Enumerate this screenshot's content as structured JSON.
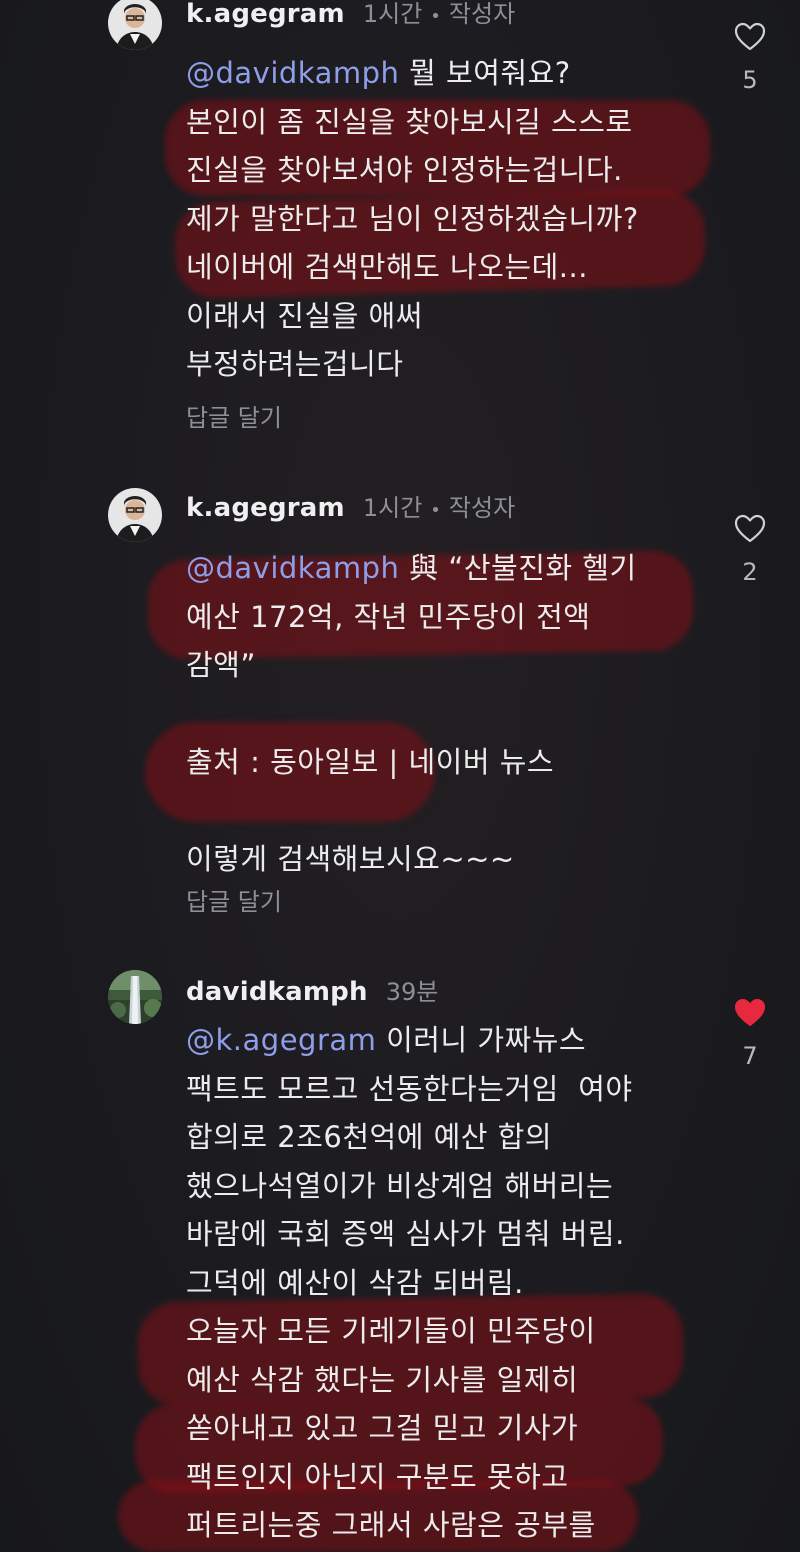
{
  "comments": [
    {
      "username": "k.agegram",
      "time": "1시간",
      "author_tag": "작성자",
      "mention": "@davidkamph",
      "first_line_rest": " 뭘 보여줘요?",
      "lines": [
        "본인이 좀 진실을 찾아보시길 스스로",
        "진실을 찾아보셔야 인정하는겁니다.",
        "제가 말한다고 님이 인정하겠습니까?",
        "네이버에 검색만해도 나오는데...",
        "이래서 진실을 애써",
        "부정하려는겁니다"
      ],
      "reply": "답글 달기",
      "likes": "5",
      "liked": false
    },
    {
      "username": "k.agegram",
      "time": "1시간",
      "author_tag": "작성자",
      "mention": "@davidkamph",
      "first_line_rest": " 與 “산불진화 헬기",
      "lines": [
        "예산 172억, 작년 민주당이 전액",
        "감액”",
        "",
        "출처 : 동아일보 | 네이버 뉴스",
        "",
        "이렇게 검색해보시요~~~"
      ],
      "reply": "답글 달기",
      "likes": "2",
      "liked": false
    },
    {
      "username": "davidkamph",
      "time": "39분",
      "mention": "@k.agegram",
      "first_line_rest": " 이러니 가짜뉴스",
      "lines": [
        "팩트도 모르고 선동한다는거임  여야",
        "합의로 2조6천억에 예산 합의",
        "했으나석열이가 비상계엄 해버리는",
        "바람에 국회 증액 심사가 멈춰 버림.",
        "그덕에 예산이 삭감 되버림.",
        "오늘자 모든 기레기들이 민주당이",
        "예산 삭감 했다는 기사를 일제히",
        "쏟아내고 있고 그걸 믿고 기사가",
        "팩트인지 아닌지 구분도 못하고",
        "퍼트리는중 그래서 사람은 공부를"
      ],
      "likes": "7",
      "liked": true
    }
  ],
  "icons": {
    "like": "heart-outline-icon",
    "liked": "heart-filled-icon",
    "separator": "dot-icon"
  },
  "colors": {
    "background": "#1b1b1f",
    "mention": "#8e9ee8",
    "liked_heart": "#e8283f",
    "highlight": "#820e16"
  }
}
